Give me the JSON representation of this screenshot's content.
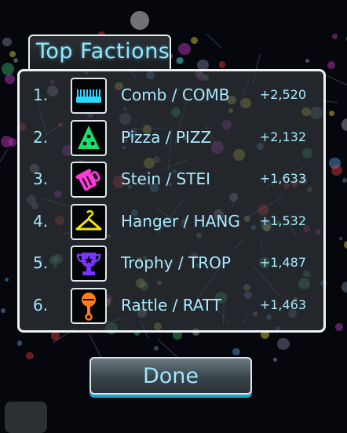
{
  "title": "Top Factions",
  "factions": [
    {
      "rank": "1.",
      "name": "Comb / COMB",
      "score": "+2,520",
      "icon": "comb-icon",
      "color": "#2ad8ff"
    },
    {
      "rank": "2.",
      "name": "Pizza / PIZZ",
      "score": "+2,132",
      "icon": "pizza-icon",
      "color": "#18e06a"
    },
    {
      "rank": "3.",
      "name": "Stein / STEI",
      "score": "+1,633",
      "icon": "stein-icon",
      "color": "#ff38d8"
    },
    {
      "rank": "4.",
      "name": "Hanger / HANG",
      "score": "+1,532",
      "icon": "hanger-icon",
      "color": "#f2e600"
    },
    {
      "rank": "5.",
      "name": "Trophy / TROP",
      "score": "+1,487",
      "icon": "trophy-icon",
      "color": "#7a36ff"
    },
    {
      "rank": "6.",
      "name": "Rattle / RATT",
      "score": "+1,463",
      "icon": "rattle-icon",
      "color": "#ff7e1a"
    }
  ],
  "done_label": "Done"
}
